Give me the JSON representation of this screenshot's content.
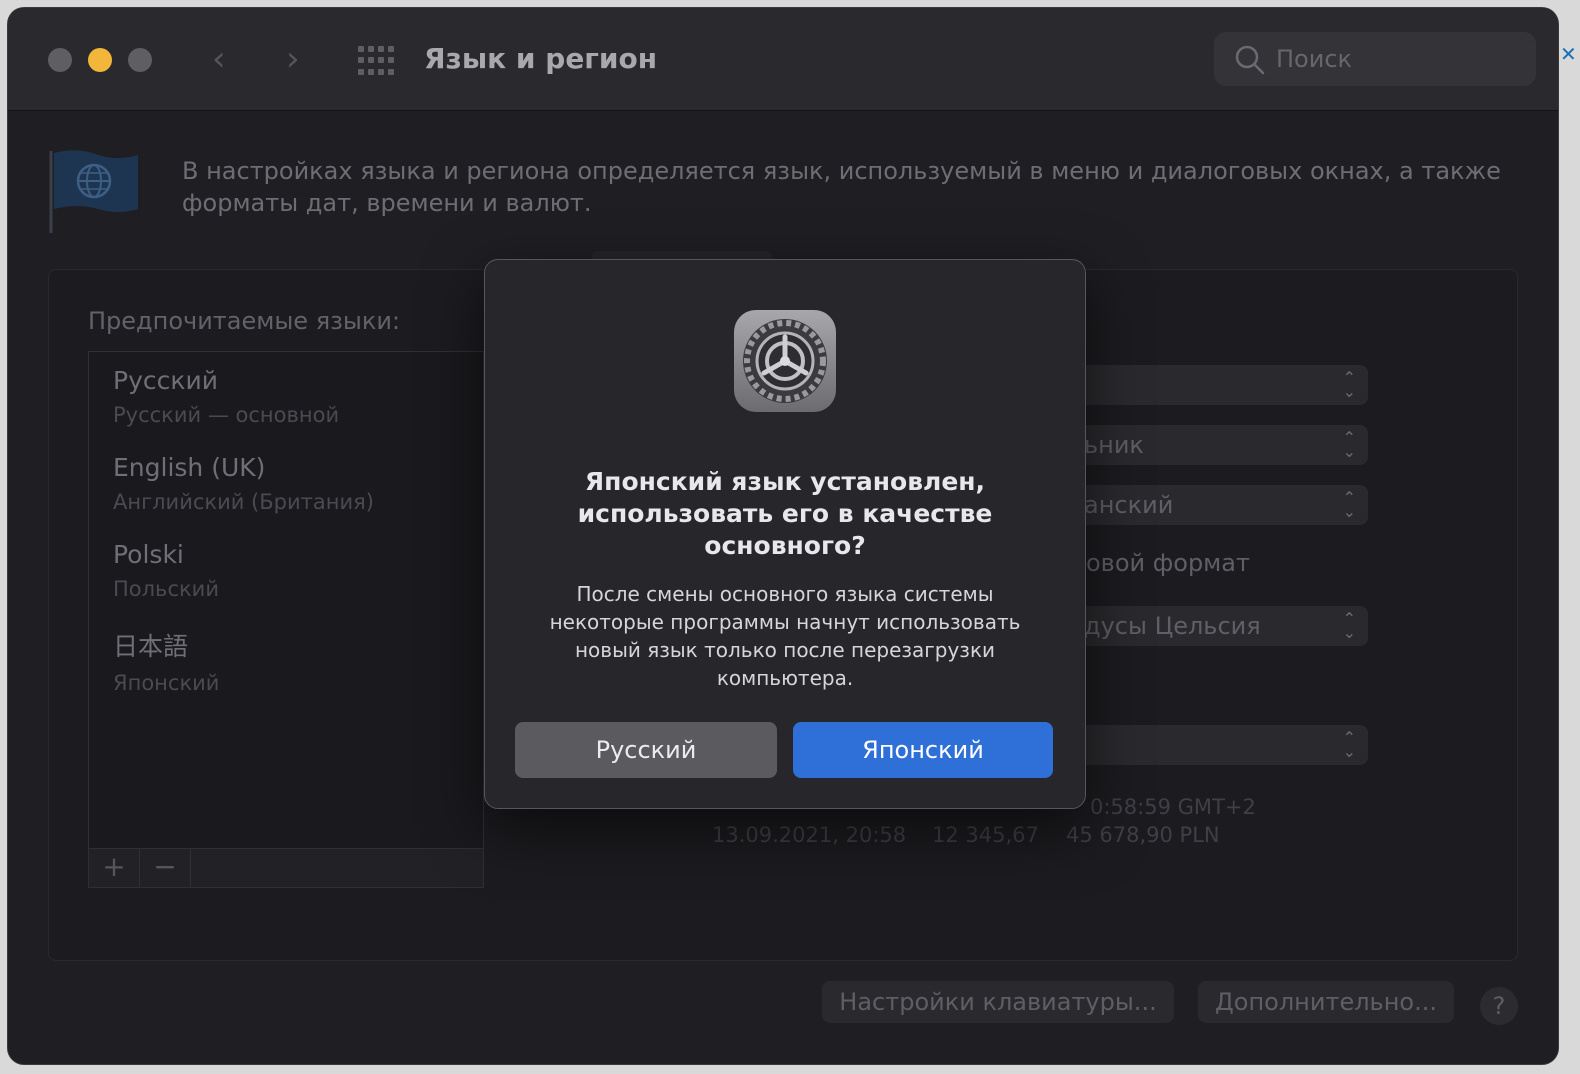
{
  "window": {
    "title": "Язык и регион",
    "search_placeholder": "Поиск",
    "traffic_lights": [
      "#5f5f63",
      "#f2b63a",
      "#5f5f63"
    ]
  },
  "description": "В настройках языка и региона определяется язык, используемый в меню и диалоговых окнах, а также форматы дат, времени и валют.",
  "preferred_languages": {
    "label": "Предпочитаемые языки:",
    "items": [
      {
        "name": "Русский",
        "sub": "Русский — основной"
      },
      {
        "name": "English (UK)",
        "sub": "Английский (Британия)"
      },
      {
        "name": "Polski",
        "sub": "Польский"
      },
      {
        "name": "日本語",
        "sub": "Японский"
      }
    ],
    "add_label": "+",
    "remove_label": "−"
  },
  "right_fields": {
    "popups": [
      "",
      "ьник",
      "анский",
      "дусы Цельсия",
      ""
    ],
    "format_label": "овой формат",
    "sample_time": "0:58:59 GMT+2",
    "sample_date": "13.09.2021, 20:58",
    "sample_number": "12 345,67",
    "sample_currency": "45 678,90 PLN"
  },
  "bottom": {
    "keyboard_button": "Настройки клавиатуры...",
    "advanced_button": "Дополнительно...",
    "help_label": "?"
  },
  "dialog": {
    "title": "Японский язык установлен, использовать его в качестве основного?",
    "body": "После смены основного языка системы некоторые программы начнут использовать новый язык только после перезагрузки компьютера.",
    "secondary_button": "Русский",
    "primary_button": "Японский",
    "accent_color": "#2f6fd8"
  }
}
